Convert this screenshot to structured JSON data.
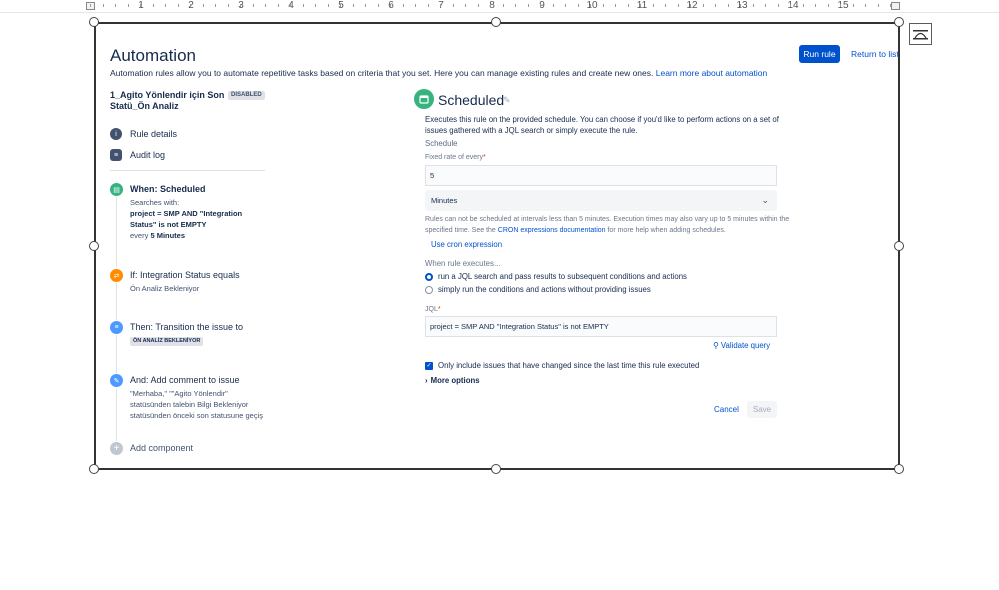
{
  "ruler": {
    "numbers": [
      "1",
      "2",
      "3",
      "4",
      "5",
      "6",
      "7",
      "8",
      "9",
      "10",
      "11",
      "12",
      "13",
      "14",
      "15"
    ]
  },
  "header": {
    "title": "Automation",
    "description": "Automation rules allow you to automate repetitive tasks based on criteria that you set. Here you can manage existing rules and create new ones.",
    "learn_more": "Learn more about automation",
    "run_rule": "Run rule",
    "return_to_list": "Return to list"
  },
  "rule": {
    "name_line1": "1_Agito Yönlendir için Son",
    "name_line2": "Statü_Ön Analiz",
    "status_badge": "DISABLED"
  },
  "nav": {
    "rule_details": "Rule details",
    "audit_log": "Audit log"
  },
  "components": {
    "trigger": {
      "title": "When: Scheduled",
      "line1": "Searches with:",
      "line2": "project = SMP AND \"Integration",
      "line3": "Status\" is not EMPTY",
      "line4_prefix": "every ",
      "line4_bold": "5 Minutes"
    },
    "condition": {
      "title": "If: Integration Status equals",
      "value": "Ön Analiz Bekleniyor"
    },
    "action1": {
      "title": "Then: Transition the issue to",
      "lozenge": "ÖN ANALİZ BEKLENİYOR"
    },
    "action2": {
      "title": "And: Add comment to issue",
      "line1": "\"Merhaba,\" \"\"Agito Yönlendir\"",
      "line2": "statüsünden talebin Bilgi Bekleniyor",
      "line3": "statüsünden önceki son statusune geçiş"
    },
    "add_component": "Add component"
  },
  "detail": {
    "title": "Scheduled",
    "intro_line1": "Executes this rule on the provided schedule. You can choose if you'd like to perform actions on a set of",
    "intro_line2": "issues gathered with a JQL search or simply execute the rule.",
    "schedule_label": "Schedule",
    "fixed_rate_label": "Fixed rate of every",
    "required_mark": "*",
    "fixed_rate_value": "5",
    "unit_value": "Minutes",
    "note_line1": "Rules can not be scheduled at intervals less than 5 minutes. Execution times may also vary up to 5 minutes within the",
    "note_line2_prefix": "specified time. See the ",
    "note_link": "CRON expressions documentation",
    "note_line2_suffix": " for more help when adding schedules.",
    "use_cron": "Use cron expression",
    "when_executes": "When rule executes...",
    "radio1": "run a JQL search and pass results to subsequent conditions and actions",
    "radio2": "simply run the conditions and actions without providing issues",
    "jql_label": "JQL",
    "jql_value": "project = SMP AND \"Integration Status\" is not EMPTY",
    "validate_query": "Validate query",
    "only_include": "Only include issues that have changed since the last time this rule executed",
    "more_options": "More options",
    "cancel": "Cancel",
    "save": "Save"
  }
}
